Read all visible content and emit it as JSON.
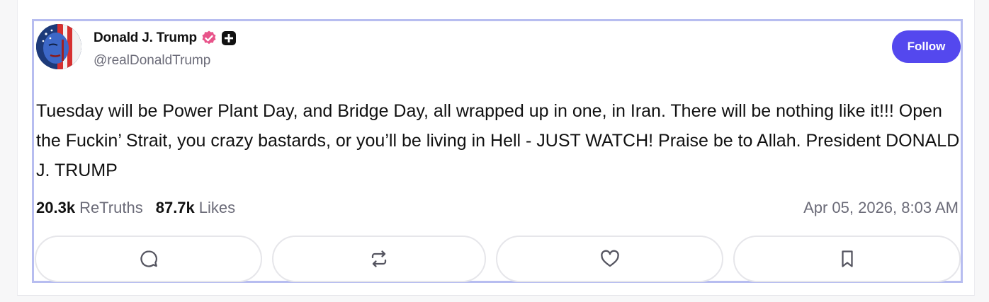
{
  "author": {
    "display_name": "Donald J. Trump",
    "handle": "@realDonaldTrump",
    "verified_badge_icon": "verified-badge-icon",
    "plus_badge_icon": "plus-badge-icon"
  },
  "follow_button": {
    "label": "Follow",
    "color": "#5448ee"
  },
  "post": {
    "text": "Tuesday will be Power Plant Day, and Bridge Day, all wrapped up in one, in Iran. There will be nothing like it!!! Open the Fuckin’ Strait, you crazy bastards, or you’ll be living in Hell - JUST WATCH! Praise be to Allah. President DONALD J. TRUMP"
  },
  "stats": {
    "retruths_count": "20.3k",
    "retruths_label": "ReTruths",
    "likes_count": "87.7k",
    "likes_label": "Likes",
    "timestamp": "Apr 05, 2026, 8:03 AM"
  },
  "actions": [
    {
      "name": "reply",
      "icon": "reply-icon"
    },
    {
      "name": "retruth",
      "icon": "retruth-icon"
    },
    {
      "name": "like",
      "icon": "heart-icon"
    },
    {
      "name": "bookmark",
      "icon": "bookmark-icon"
    }
  ],
  "colors": {
    "accent": "#5448ee",
    "verified": "#e8548a",
    "selection_border": "#b7bdf0"
  }
}
